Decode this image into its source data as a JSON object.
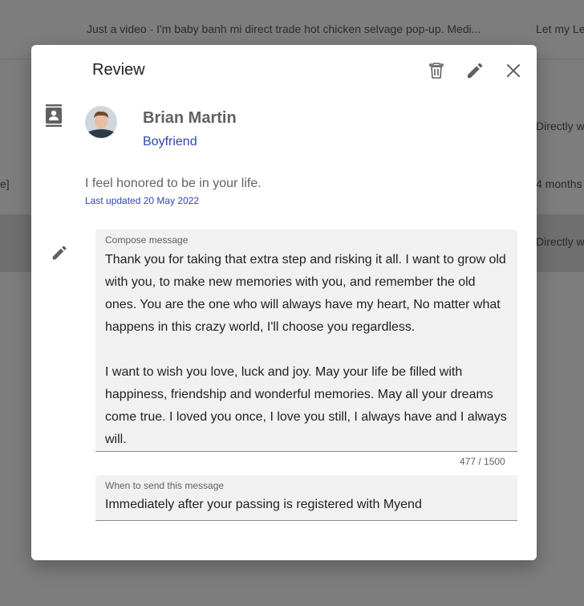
{
  "background": {
    "rows": [
      {
        "title": "Just a video",
        "separator": " - ",
        "snippet": "I'm baby banh mi direct trade hot chicken selvage pop-up. Medi...",
        "right_text": "Let my Le"
      },
      {
        "right_text": "Directly w"
      },
      {
        "left_text": "e]",
        "right_text": "4 months"
      },
      {
        "right_text": "Directly w"
      }
    ]
  },
  "dialog": {
    "title": "Review",
    "actions": {
      "delete_icon": "trash-icon",
      "edit_icon": "pencil-icon",
      "close_icon": "close-icon"
    },
    "contact": {
      "icon": "contact-card-icon",
      "name": "Brian Martin",
      "relation": "Boyfriend"
    },
    "summary": "I feel honored to be in your life.",
    "updated": "Last updated 20 May 2022",
    "compose": {
      "label": "Compose message",
      "text": "Thank you for taking that extra step and risking it all. I want to grow old with you, to make new memories with you, and remember the old ones. You are the one who will always have my heart, No matter what happens in this crazy world, I'll choose you regardless.\n\nI want to wish you love, luck and joy. May your life be filled with happiness, friendship and wonderful memories. May all your dreams come true. I loved you once, I love you still, I always have and I always will.",
      "counter": "477 / 1500"
    },
    "when": {
      "label": "When to send this message",
      "value": "Immediately after your passing is registered with Myend"
    }
  },
  "colors": {
    "accent": "#2f46b4",
    "overlay": "#7d7d7d"
  }
}
